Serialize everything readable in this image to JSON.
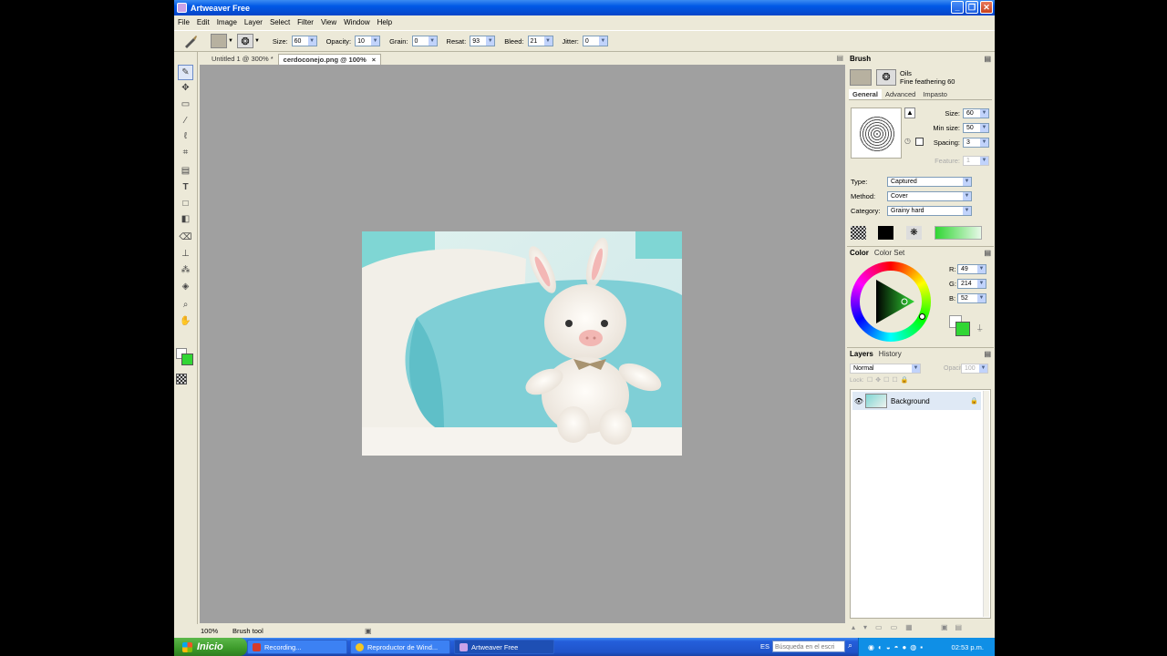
{
  "window": {
    "title": "Artweaver Free"
  },
  "menu": [
    "File",
    "Edit",
    "Image",
    "Layer",
    "Select",
    "Filter",
    "View",
    "Window",
    "Help"
  ],
  "options": {
    "size_label": "Size:",
    "size": "60",
    "opacity_label": "Opacity:",
    "opacity": "10",
    "grain_label": "Grain:",
    "grain": "0",
    "resat_label": "Resat:",
    "resat": "93",
    "bleed_label": "Bleed:",
    "bleed": "21",
    "jitter_label": "Jitter:",
    "jitter": "0"
  },
  "tabs": [
    {
      "label": "Untitled 1 @ 300% *"
    },
    {
      "label": "cerdoconejo.png @ 100%",
      "close": "×"
    }
  ],
  "status": {
    "zoom": "100%",
    "tool": "Brush tool"
  },
  "brush_panel": {
    "title": "Brush",
    "category": "Oils",
    "variant": "Fine feathering 60",
    "tabs": [
      "General",
      "Advanced",
      "Impasto"
    ],
    "size_label": "Size:",
    "size": "60",
    "min_size_label": "Min size:",
    "min_size": "50",
    "spacing_label": "Spacing:",
    "spacing": "3",
    "feature_label": "Feature:",
    "feature": "1",
    "type_label": "Type:",
    "type": "Captured",
    "method_label": "Method:",
    "method": "Cover",
    "category_label": "Category:",
    "category_value": "Grainy hard"
  },
  "color_panel": {
    "tabs": [
      "Color",
      "Color Set"
    ],
    "r_label": "R:",
    "r": "49",
    "g_label": "G:",
    "g": "214",
    "b_label": "B:",
    "b": "52",
    "current_color": "#31d634"
  },
  "layers_panel": {
    "tabs": [
      "Layers",
      "History"
    ],
    "blend_mode": "Normal",
    "opacity_label": "Opacity:",
    "opacity": "100",
    "lock_label": "Lock:",
    "layers": [
      {
        "name": "Background"
      }
    ]
  },
  "taskbar": {
    "start": "Inicio",
    "tasks": [
      "Recording...",
      "Reproductor de Wind...",
      "Artweaver Free"
    ],
    "language": "ES",
    "search_placeholder": "Búsqueda en el escri",
    "clock": "02:53 p.m."
  }
}
